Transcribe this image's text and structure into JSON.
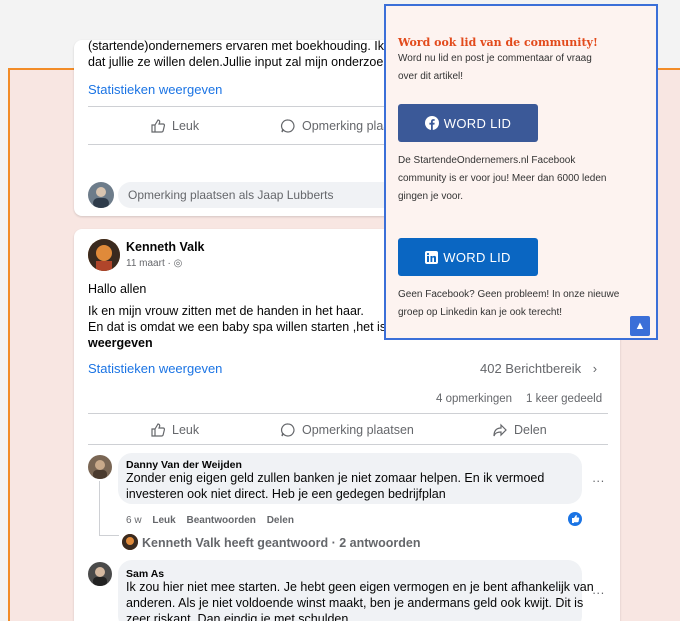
{
  "post1": {
    "text_line1": "(startende)ondernemers ervaren met boekhouding. Ik wa",
    "text_line2": "dat jullie ze willen delen.Jullie input zal mijn onderzoek b",
    "stats_link": "Statistieken weergeven",
    "like_label": "Leuk",
    "comment_label": "Opmerking plaatsen",
    "comment_placeholder": "Opmerking plaatsen als Jaap Lubberts"
  },
  "post2": {
    "author": "Kenneth Valk",
    "date": "11 maart",
    "greeting": "Hallo allen",
    "line1": "Ik en mijn vrouw zitten met de handen in het haar.",
    "line2": "En dat is omdat we een baby spa willen starten ,het is ec",
    "see_more": "weergeven",
    "stats_link": "Statistieken weergeven",
    "reach": "402 Berichtbereik",
    "comments_count": "4 opmerkingen",
    "shares": "1 keer gedeeld",
    "like_label": "Leuk",
    "comment_label": "Opmerking plaatsen",
    "share_label": "Delen"
  },
  "comments": [
    {
      "author": "Danny Van der Weijden",
      "line1": "Zonder enig eigen geld zullen banken je niet zomaar helpen. En ik vermoed",
      "line2": "investeren ook niet direct. Heb je een gedegen bedrijfplan",
      "time": "6 w",
      "like": "Leuk",
      "reply": "Beantwoorden",
      "share": "Delen",
      "replies_summary": "Kenneth Valk heeft geantwoord · 2 antwoorden"
    },
    {
      "author": "Sam As",
      "line1": "Ik zou hier niet mee starten. Je hebt geen eigen vermogen en je bent afhankelijk van",
      "line2": "anderen. Als je niet voldoende winst maakt, ben je andermans geld ook kwijt. Dit is",
      "line3": "zeer riskant. Dan eindig je met schulden."
    }
  ],
  "popup": {
    "title": "Word ook lid van de community!",
    "intro_line1": "Word nu lid en post je commentaar of vraag",
    "intro_line2": "over dit artikel!",
    "fb_button": "WORD LID",
    "fb_text_line1": "De StartendeOndernemers.nl Facebook",
    "fb_text_line2": "community is er voor jou! Meer dan 6000 leden",
    "fb_text_line3": "gingen je voor.",
    "li_button": "WORD LID",
    "li_text_line1": "Geen Facebook? Geen probleem! In onze nieuwe",
    "li_text_line2": "groep op Linkedin kan je ook terecht!"
  },
  "colors": {
    "accent_orange": "#f28c28",
    "popup_border": "#3b6fd8",
    "facebook_button": "#3b5998",
    "linkedin_button": "#0a66c2",
    "link_blue": "#1b74e4"
  }
}
